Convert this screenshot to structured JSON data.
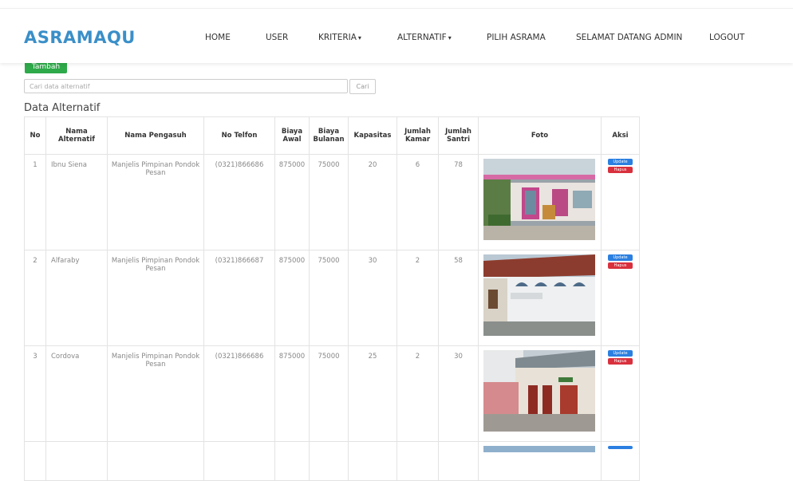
{
  "navbar": {
    "brand": "ASRAMAQU",
    "items": [
      {
        "label": "HOME"
      },
      {
        "label": "USER"
      },
      {
        "label": "KRITERIA",
        "caret": "▾"
      },
      {
        "label": "ALTERNATIF",
        "caret": "▾"
      },
      {
        "label": "PILIH ASRAMA"
      },
      {
        "label": "SELAMAT DATANG ADMIN"
      },
      {
        "label": "LOGOUT"
      }
    ]
  },
  "tambah_label": "Tambah",
  "search": {
    "placeholder": "Cari data alternatif",
    "button": "Cari"
  },
  "section_title": "Data Alternatif",
  "table": {
    "headers": [
      "No",
      "Nama Alternatif",
      "Nama Pengasuh",
      "No Telfon",
      "Biaya Awal",
      "Biaya Bulanan",
      "Kapasitas",
      "Jumlah Kamar",
      "Jumlah Santri",
      "Foto",
      "Aksi"
    ],
    "rows": [
      {
        "no": "1",
        "nama": "Ibnu Siena",
        "pengasuh": "Manjelis Pimpinan Pondok Pesan",
        "telfon": "(0321)866686",
        "biaya_awal": "875000",
        "biaya_bulanan": "75000",
        "kapasitas": "20",
        "kamar": "6",
        "santri": "78",
        "foto": "photo-building-pink-doors"
      },
      {
        "no": "2",
        "nama": "Alfaraby",
        "pengasuh": "Manjelis Pimpinan Pondok Pesan",
        "telfon": "(0321)866687",
        "biaya_awal": "875000",
        "biaya_bulanan": "75000",
        "kapasitas": "30",
        "kamar": "2",
        "santri": "58",
        "foto": "photo-building-white-arches"
      },
      {
        "no": "3",
        "nama": "Cordova",
        "pengasuh": "Manjelis Pimpinan Pondok Pesan",
        "telfon": "(0321)866686",
        "biaya_awal": "875000",
        "biaya_bulanan": "75000",
        "kapasitas": "25",
        "kamar": "2",
        "santri": "30",
        "foto": "photo-building-red-doors"
      }
    ],
    "actions": {
      "update": "Update",
      "hapus": "Hapus"
    }
  }
}
